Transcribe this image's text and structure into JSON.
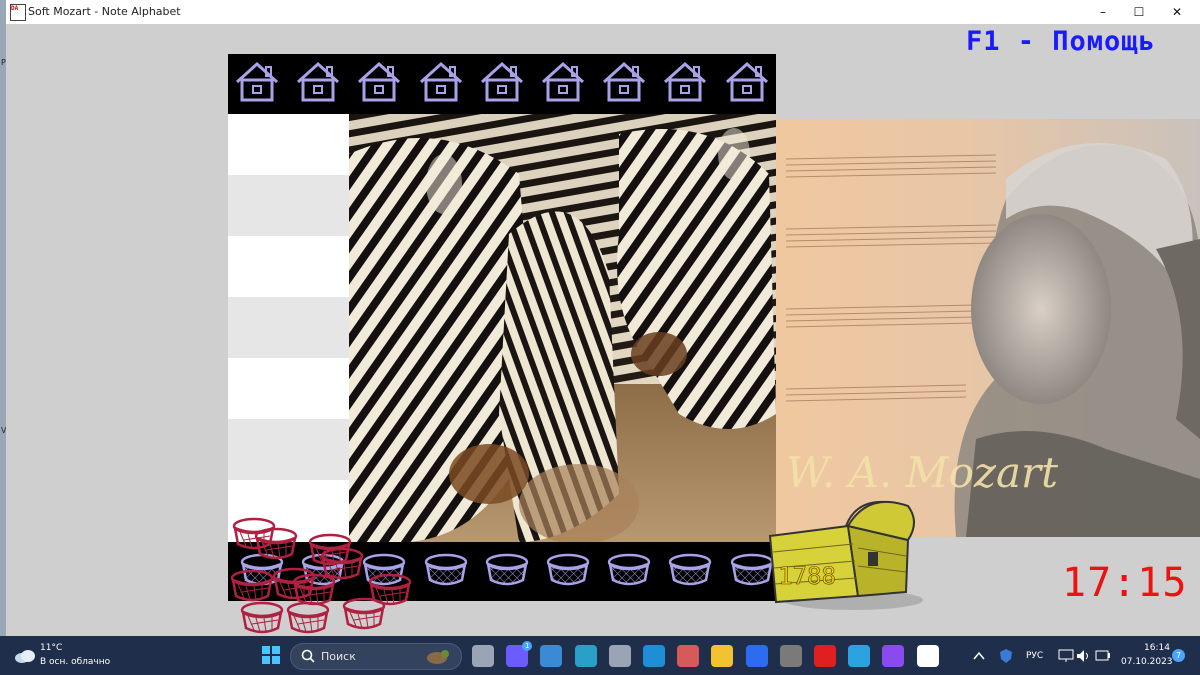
{
  "window": {
    "title": "Soft Mozart - Note Alphabet",
    "icon_text": "DA",
    "minimize_label": "–",
    "maximize_label": "☐",
    "close_label": "✕"
  },
  "game": {
    "help_text": "F1 - Помощь",
    "clock": "17:15",
    "score": "1788",
    "houses_count": 9,
    "baskets_count": 9,
    "picture_main": "zebras-photo",
    "picture_side": "mozart-portrait",
    "side_signature": "W. A. Mozart",
    "colors": {
      "help": "#1a1aff",
      "clock": "#ee1111",
      "house_outline": "#a8a2e8",
      "red_basket": "#b02040",
      "chest": "#d8d23a"
    }
  },
  "taskbar": {
    "temperature": "11°C",
    "condition": "В осн. облачно",
    "search_placeholder": "Поиск",
    "language": "РУС",
    "time": "16:14",
    "date": "07.10.2023",
    "notification_count": "7",
    "chat_badge": "1",
    "pinned_icons": [
      "task-view-icon",
      "chat-icon",
      "snipping-icon",
      "keyboard-icon",
      "calculator-icon",
      "edge-dev-icon",
      "paint-icon",
      "file-explorer-icon",
      "zoom-icon",
      "usb-icon",
      "yandex-icon",
      "telegram-icon",
      "obsidian-icon",
      "soft-mozart-icon"
    ]
  }
}
